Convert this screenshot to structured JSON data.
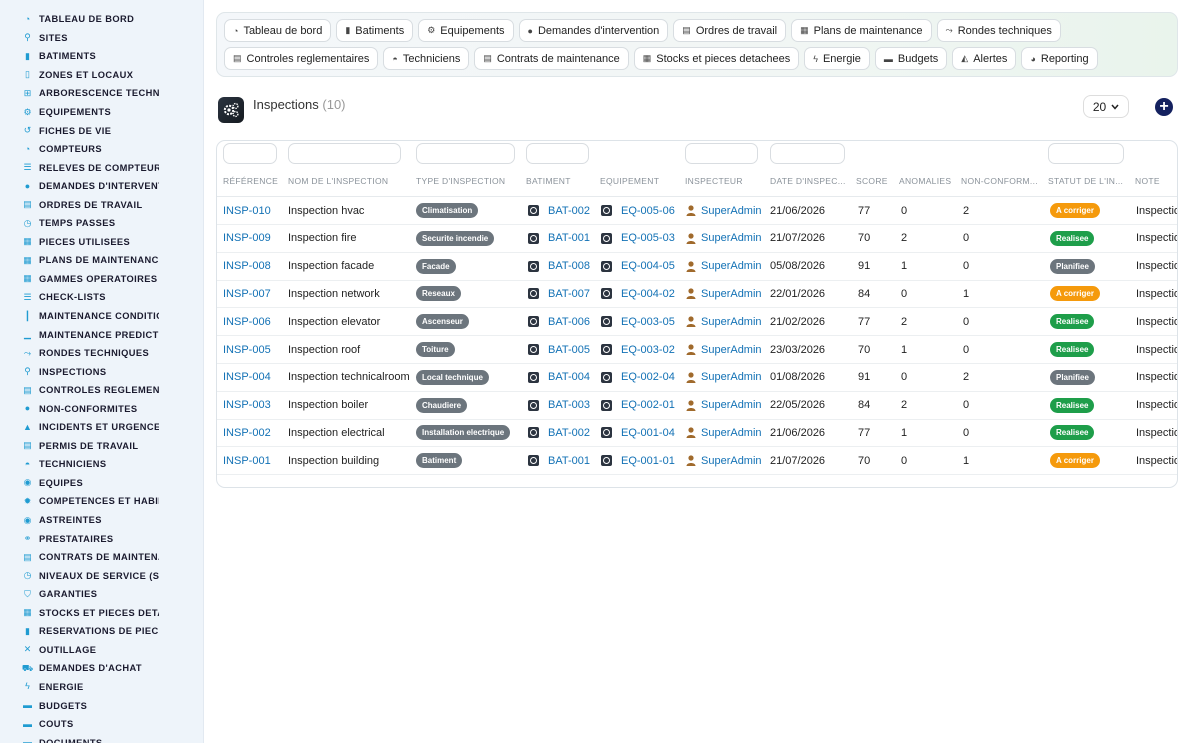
{
  "sidebar": {
    "items": [
      {
        "label": "TABLEAU DE BORD",
        "icon": "dashboard-icon",
        "glyph": "◔"
      },
      {
        "label": "SITES",
        "icon": "map-pin-icon",
        "glyph": "⚲"
      },
      {
        "label": "BATIMENTS",
        "icon": "building-icon",
        "glyph": "▮"
      },
      {
        "label": "ZONES ET LOCAUX",
        "icon": "door-icon",
        "glyph": "▯"
      },
      {
        "label": "ARBORESCENCE TECHNIQUE",
        "icon": "sitemap-icon",
        "glyph": "⊞"
      },
      {
        "label": "EQUIPEMENTS",
        "icon": "gears-icon",
        "glyph": "⚙"
      },
      {
        "label": "FICHES DE VIE",
        "icon": "history-icon",
        "glyph": "↺"
      },
      {
        "label": "COMPTEURS",
        "icon": "gauge-icon",
        "glyph": "◔"
      },
      {
        "label": "RELEVES DE COMPTEURS",
        "icon": "list-icon",
        "glyph": "☰"
      },
      {
        "label": "DEMANDES D'INTERVENTION",
        "icon": "question-icon",
        "glyph": "●"
      },
      {
        "label": "ORDRES DE TRAVAIL",
        "icon": "clipboard-icon",
        "glyph": "▤"
      },
      {
        "label": "TEMPS PASSES",
        "icon": "clock-icon",
        "glyph": "◷"
      },
      {
        "label": "PIECES UTILISEES",
        "icon": "boxes-icon",
        "glyph": "▦"
      },
      {
        "label": "PLANS DE MAINTENANCE",
        "icon": "calendar-icon",
        "glyph": "▦"
      },
      {
        "label": "GAMMES OPERATOIRES",
        "icon": "grid-icon",
        "glyph": "▦"
      },
      {
        "label": "CHECK-LISTS",
        "icon": "checklist-icon",
        "glyph": "☰"
      },
      {
        "label": "MAINTENANCE CONDITIONNELLE",
        "icon": "thermometer-icon",
        "glyph": "┃"
      },
      {
        "label": "MAINTENANCE PREDICTIVE",
        "icon": "chart-icon",
        "glyph": "▁"
      },
      {
        "label": "RONDES TECHNIQUES",
        "icon": "route-icon",
        "glyph": "⤳"
      },
      {
        "label": "INSPECTIONS",
        "icon": "search-icon",
        "glyph": "⚲"
      },
      {
        "label": "CONTROLES REGLEMENTAIRES",
        "icon": "clipboard-check-icon",
        "glyph": "▤"
      },
      {
        "label": "NON-CONFORMITES",
        "icon": "alert-circle-icon",
        "glyph": "●"
      },
      {
        "label": "INCIDENTS ET URGENCES",
        "icon": "warning-icon",
        "glyph": "▲"
      },
      {
        "label": "PERMIS DE TRAVAIL",
        "icon": "file-signature-icon",
        "glyph": "▤"
      },
      {
        "label": "TECHNICIENS",
        "icon": "hard-hat-icon",
        "glyph": "◓"
      },
      {
        "label": "EQUIPES",
        "icon": "users-icon",
        "glyph": "◉"
      },
      {
        "label": "COMPETENCES ET HABILITATIONS",
        "icon": "certificate-icon",
        "glyph": "✹"
      },
      {
        "label": "ASTREINTES",
        "icon": "user-clock-icon",
        "glyph": "◉"
      },
      {
        "label": "PRESTATAIRES",
        "icon": "handshake-icon",
        "glyph": "⚭"
      },
      {
        "label": "CONTRATS DE MAINTENANCE",
        "icon": "contract-icon",
        "glyph": "▤"
      },
      {
        "label": "NIVEAUX DE SERVICE (SLA)",
        "icon": "stopwatch-icon",
        "glyph": "◷"
      },
      {
        "label": "GARANTIES",
        "icon": "shield-icon",
        "glyph": "⛉"
      },
      {
        "label": "STOCKS ET PIECES DETACHEES",
        "icon": "boxes-icon",
        "glyph": "▦"
      },
      {
        "label": "RESERVATIONS DE PIECES",
        "icon": "bookmark-icon",
        "glyph": "▮"
      },
      {
        "label": "OUTILLAGE",
        "icon": "tools-icon",
        "glyph": "✕"
      },
      {
        "label": "DEMANDES D'ACHAT",
        "icon": "cart-icon",
        "glyph": "⛟"
      },
      {
        "label": "ENERGIE",
        "icon": "bolt-icon",
        "glyph": "ϟ"
      },
      {
        "label": "BUDGETS",
        "icon": "money-icon",
        "glyph": "▬"
      },
      {
        "label": "COUTS",
        "icon": "coins-icon",
        "glyph": "▬"
      },
      {
        "label": "DOCUMENTS",
        "icon": "folder-icon",
        "glyph": "▬"
      }
    ]
  },
  "nav": {
    "row1": [
      {
        "label": "Tableau de bord",
        "icon": "gauge-icon",
        "glyph": "◔"
      },
      {
        "label": "Batiments",
        "icon": "building-icon",
        "glyph": "▮"
      },
      {
        "label": "Equipements",
        "icon": "gears-icon",
        "glyph": "⚙"
      },
      {
        "label": "Demandes d'intervention",
        "icon": "question-icon",
        "glyph": "●"
      },
      {
        "label": "Ordres de travail",
        "icon": "clipboard-icon",
        "glyph": "▤"
      },
      {
        "label": "Plans de maintenance",
        "icon": "calendar-icon",
        "glyph": "▦"
      },
      {
        "label": "Rondes techniques",
        "icon": "route-icon",
        "glyph": "⤳"
      }
    ],
    "row2": [
      {
        "label": "Controles reglementaires",
        "icon": "clipboard-check-icon",
        "glyph": "▤"
      },
      {
        "label": "Techniciens",
        "icon": "hard-hat-icon",
        "glyph": "◓"
      },
      {
        "label": "Contrats de maintenance",
        "icon": "contract-icon",
        "glyph": "▤"
      },
      {
        "label": "Stocks et pieces detachees",
        "icon": "boxes-icon",
        "glyph": "▦"
      },
      {
        "label": "Energie",
        "icon": "bolt-icon",
        "glyph": "ϟ"
      },
      {
        "label": "Budgets",
        "icon": "money-icon",
        "glyph": "▬"
      },
      {
        "label": "Alertes",
        "icon": "bell-icon",
        "glyph": "◭"
      },
      {
        "label": "Reporting",
        "icon": "pie-chart-icon",
        "glyph": "◕"
      }
    ]
  },
  "page": {
    "title": "Inspections",
    "count": "(10)",
    "per_page": "20",
    "add_label": "+"
  },
  "table": {
    "columns": [
      "RÉFÉRENCE",
      "NOM DE L'INSPECTION",
      "TYPE D'INSPECTION",
      "BATIMENT",
      "EQUIPEMENT",
      "INSPECTEUR",
      "DATE D'INSPEC...",
      "SCORE",
      "ANOMALIES",
      "NON-CONFORM...",
      "STATUT DE L'IN...",
      "NOTE"
    ],
    "rows": [
      {
        "ref": "INSP-010",
        "name": "Inspection hvac",
        "type": "Climatisation",
        "bat": "BAT-002",
        "eq": "EQ-005-06",
        "inspector": "SuperAdmin",
        "date": "21/06/2026",
        "score": "77",
        "anomalies": "0",
        "nc": "2",
        "status": "A corriger",
        "status_color": "#f59a0c",
        "note": "Inspection"
      },
      {
        "ref": "INSP-009",
        "name": "Inspection fire",
        "type": "Securite incendie",
        "bat": "BAT-001",
        "eq": "EQ-005-03",
        "inspector": "SuperAdmin",
        "date": "21/07/2026",
        "score": "70",
        "anomalies": "2",
        "nc": "0",
        "status": "Realisee",
        "status_color": "#1e9e4a",
        "note": "Inspection"
      },
      {
        "ref": "INSP-008",
        "name": "Inspection facade",
        "type": "Facade",
        "bat": "BAT-008",
        "eq": "EQ-004-05",
        "inspector": "SuperAdmin",
        "date": "05/08/2026",
        "score": "91",
        "anomalies": "1",
        "nc": "0",
        "status": "Planifiee",
        "status_color": "#6c757d",
        "note": "Inspection"
      },
      {
        "ref": "INSP-007",
        "name": "Inspection network",
        "type": "Reseaux",
        "bat": "BAT-007",
        "eq": "EQ-004-02",
        "inspector": "SuperAdmin",
        "date": "22/01/2026",
        "score": "84",
        "anomalies": "0",
        "nc": "1",
        "status": "A corriger",
        "status_color": "#f59a0c",
        "note": "Inspection"
      },
      {
        "ref": "INSP-006",
        "name": "Inspection elevator",
        "type": "Ascenseur",
        "bat": "BAT-006",
        "eq": "EQ-003-05",
        "inspector": "SuperAdmin",
        "date": "21/02/2026",
        "score": "77",
        "anomalies": "2",
        "nc": "0",
        "status": "Realisee",
        "status_color": "#1e9e4a",
        "note": "Inspection"
      },
      {
        "ref": "INSP-005",
        "name": "Inspection roof",
        "type": "Toiture",
        "bat": "BAT-005",
        "eq": "EQ-003-02",
        "inspector": "SuperAdmin",
        "date": "23/03/2026",
        "score": "70",
        "anomalies": "1",
        "nc": "0",
        "status": "Realisee",
        "status_color": "#1e9e4a",
        "note": "Inspection"
      },
      {
        "ref": "INSP-004",
        "name": "Inspection technicalroom",
        "type": "Local technique",
        "bat": "BAT-004",
        "eq": "EQ-002-04",
        "inspector": "SuperAdmin",
        "date": "01/08/2026",
        "score": "91",
        "anomalies": "0",
        "nc": "2",
        "status": "Planifiee",
        "status_color": "#6c757d",
        "note": "Inspection"
      },
      {
        "ref": "INSP-003",
        "name": "Inspection boiler",
        "type": "Chaudiere",
        "bat": "BAT-003",
        "eq": "EQ-002-01",
        "inspector": "SuperAdmin",
        "date": "22/05/2026",
        "score": "84",
        "anomalies": "2",
        "nc": "0",
        "status": "Realisee",
        "status_color": "#1e9e4a",
        "note": "Inspection"
      },
      {
        "ref": "INSP-002",
        "name": "Inspection electrical",
        "type": "Installation electrique",
        "bat": "BAT-002",
        "eq": "EQ-001-04",
        "inspector": "SuperAdmin",
        "date": "21/06/2026",
        "score": "77",
        "anomalies": "1",
        "nc": "0",
        "status": "Realisee",
        "status_color": "#1e9e4a",
        "note": "Inspection"
      },
      {
        "ref": "INSP-001",
        "name": "Inspection building",
        "type": "Batiment",
        "bat": "BAT-001",
        "eq": "EQ-001-01",
        "inspector": "SuperAdmin",
        "date": "21/07/2026",
        "score": "70",
        "anomalies": "0",
        "nc": "1",
        "status": "A corriger",
        "status_color": "#f59a0c",
        "note": "Inspection"
      }
    ]
  }
}
